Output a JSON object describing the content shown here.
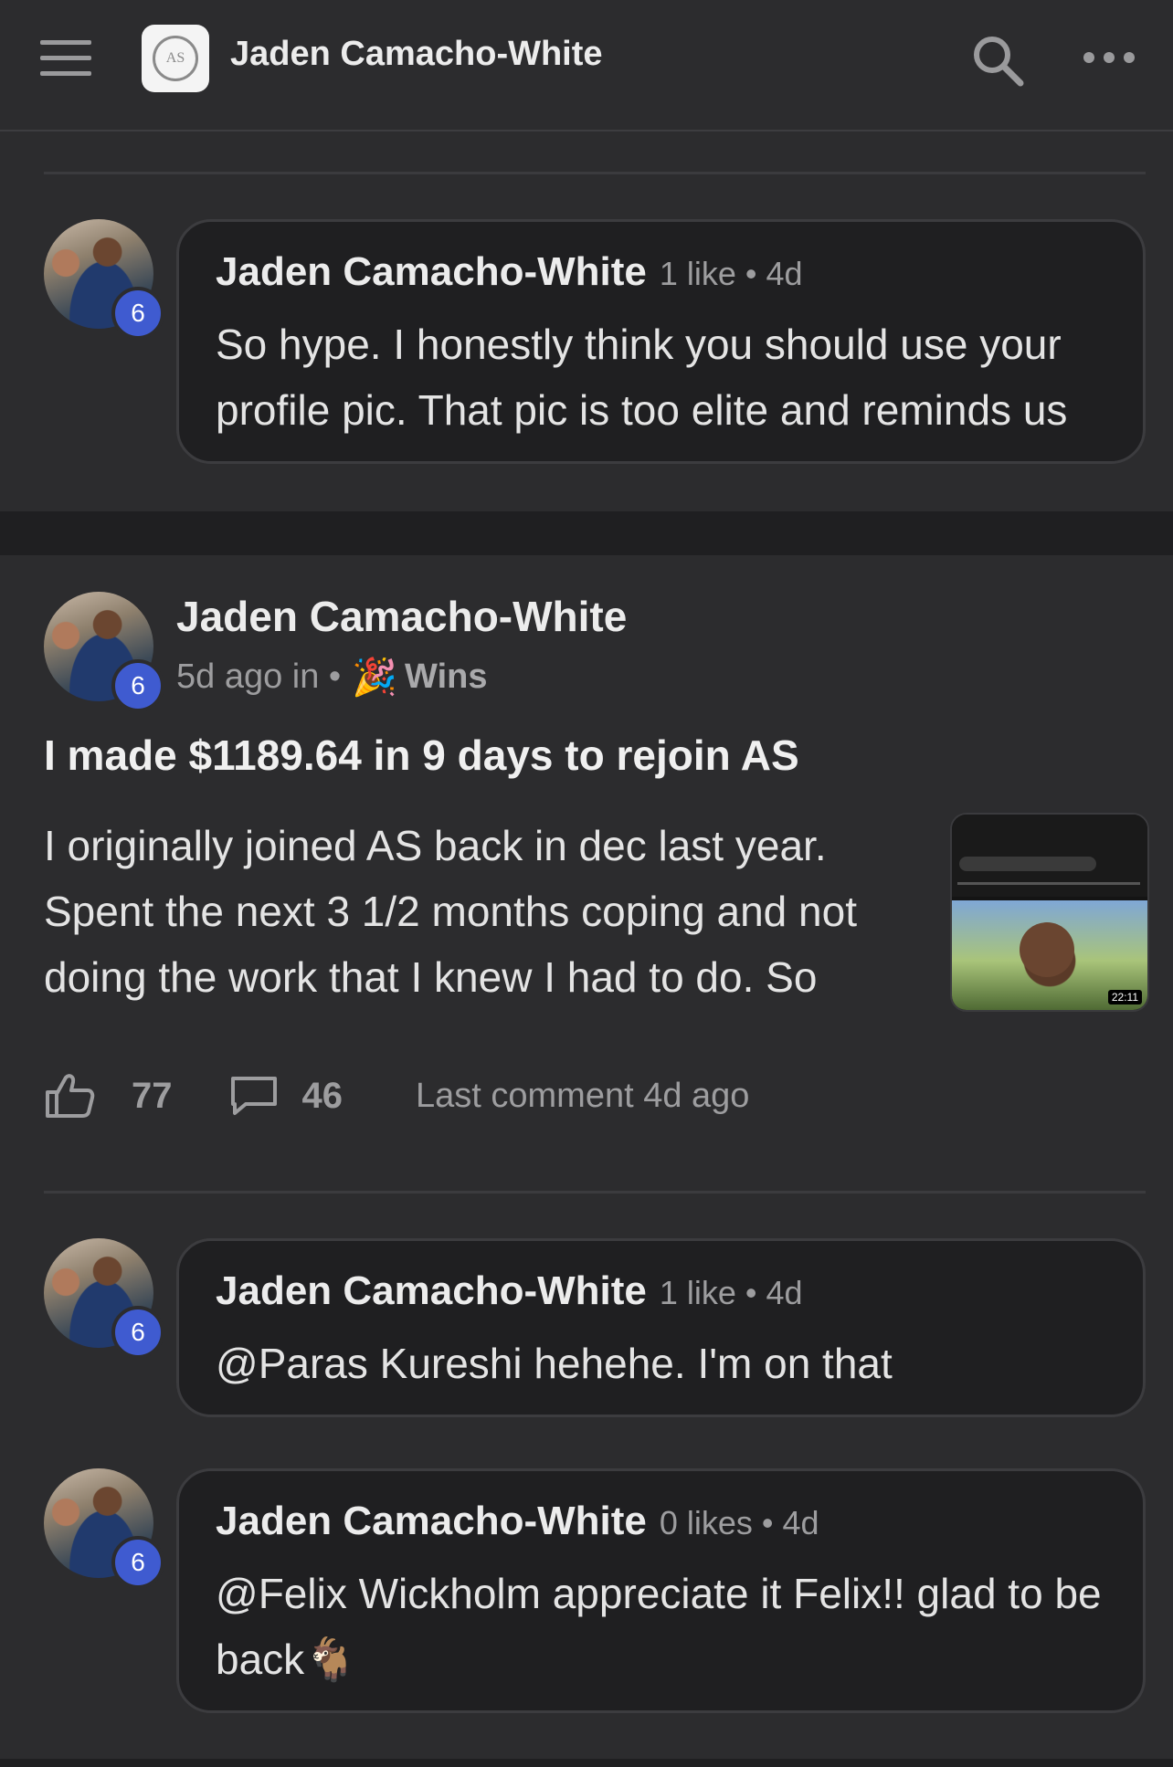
{
  "header": {
    "title": "Jaden Camacho-White",
    "logo_text": "AS",
    "icons": [
      "menu-icon",
      "search-icon",
      "more-icon"
    ]
  },
  "comments_top": [
    {
      "author": "Jaden Camacho-White",
      "meta": "1 like • 4d",
      "text": "So hype. I honestly think you should use your profile pic. That pic is too elite and reminds us",
      "level": "6"
    }
  ],
  "post": {
    "author": "Jaden Camacho-White",
    "level": "6",
    "meta_prefix": "5d ago in •",
    "category_icon": "🎉",
    "category": "Wins",
    "title": "I made $1189.64 in 9 days to rejoin AS",
    "body": "I originally joined AS back in dec last year. Spent the next 3 1/2 months coping and not doing the work that I knew I had to do. So",
    "thumbnail_time": "22:11",
    "likes": "77",
    "comments": "46",
    "last_comment": "Last comment 4d ago"
  },
  "comments_bottom": [
    {
      "author": "Jaden Camacho-White",
      "meta": "1 like • 4d",
      "text": "@Paras Kureshi hehehe. I'm on that",
      "level": "6"
    },
    {
      "author": "Jaden Camacho-White",
      "meta": "0 likes • 4d",
      "text": "@Felix Wickholm appreciate it Felix!! glad to be back🐐",
      "level": "6"
    }
  ],
  "colors": {
    "background": "#2c2c2e",
    "bubble": "#1f1f21",
    "level_badge": "#3f5bd0"
  }
}
